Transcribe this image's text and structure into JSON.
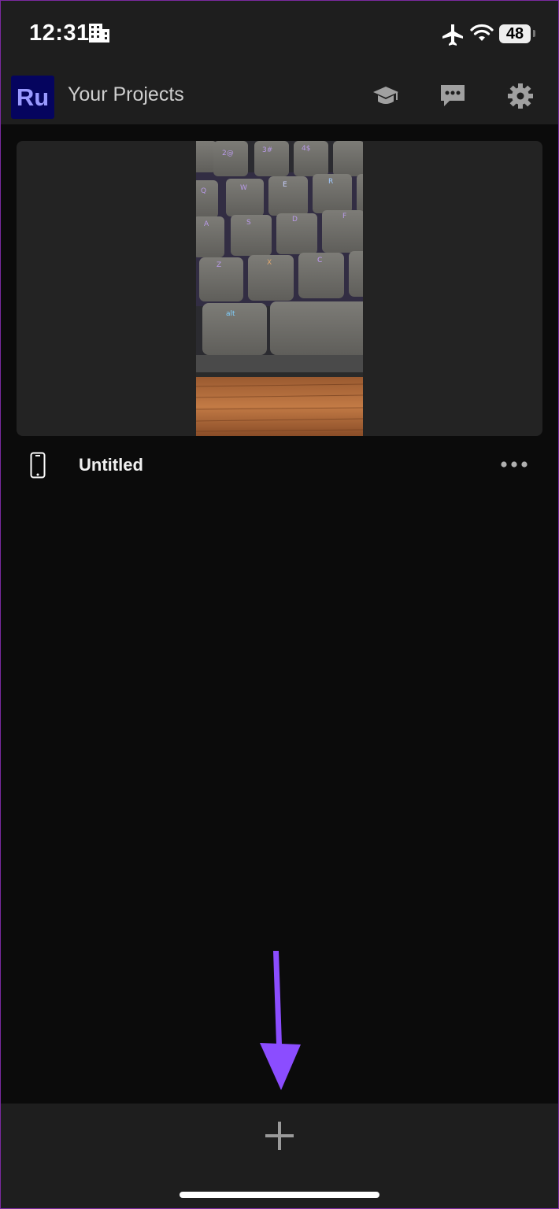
{
  "status_bar": {
    "time": "12:31",
    "battery": "48"
  },
  "header": {
    "logo": "Ru",
    "title": "Your Projects"
  },
  "projects": [
    {
      "name": "Untitled"
    }
  ],
  "colors": {
    "background": "#0b0b0b",
    "bar": "#1e1e1e",
    "card": "#232323",
    "logo_bg": "#05045e",
    "logo_text": "#9999ff",
    "arrow": "#8b4dff"
  },
  "icons": {
    "status": [
      "building-icon",
      "airplane-icon",
      "wifi-icon",
      "battery-icon"
    ],
    "header": [
      "graduation-cap-icon",
      "feedback-icon",
      "gear-icon"
    ],
    "project": [
      "phone-icon",
      "more-icon"
    ],
    "bottom": [
      "plus-icon"
    ]
  }
}
